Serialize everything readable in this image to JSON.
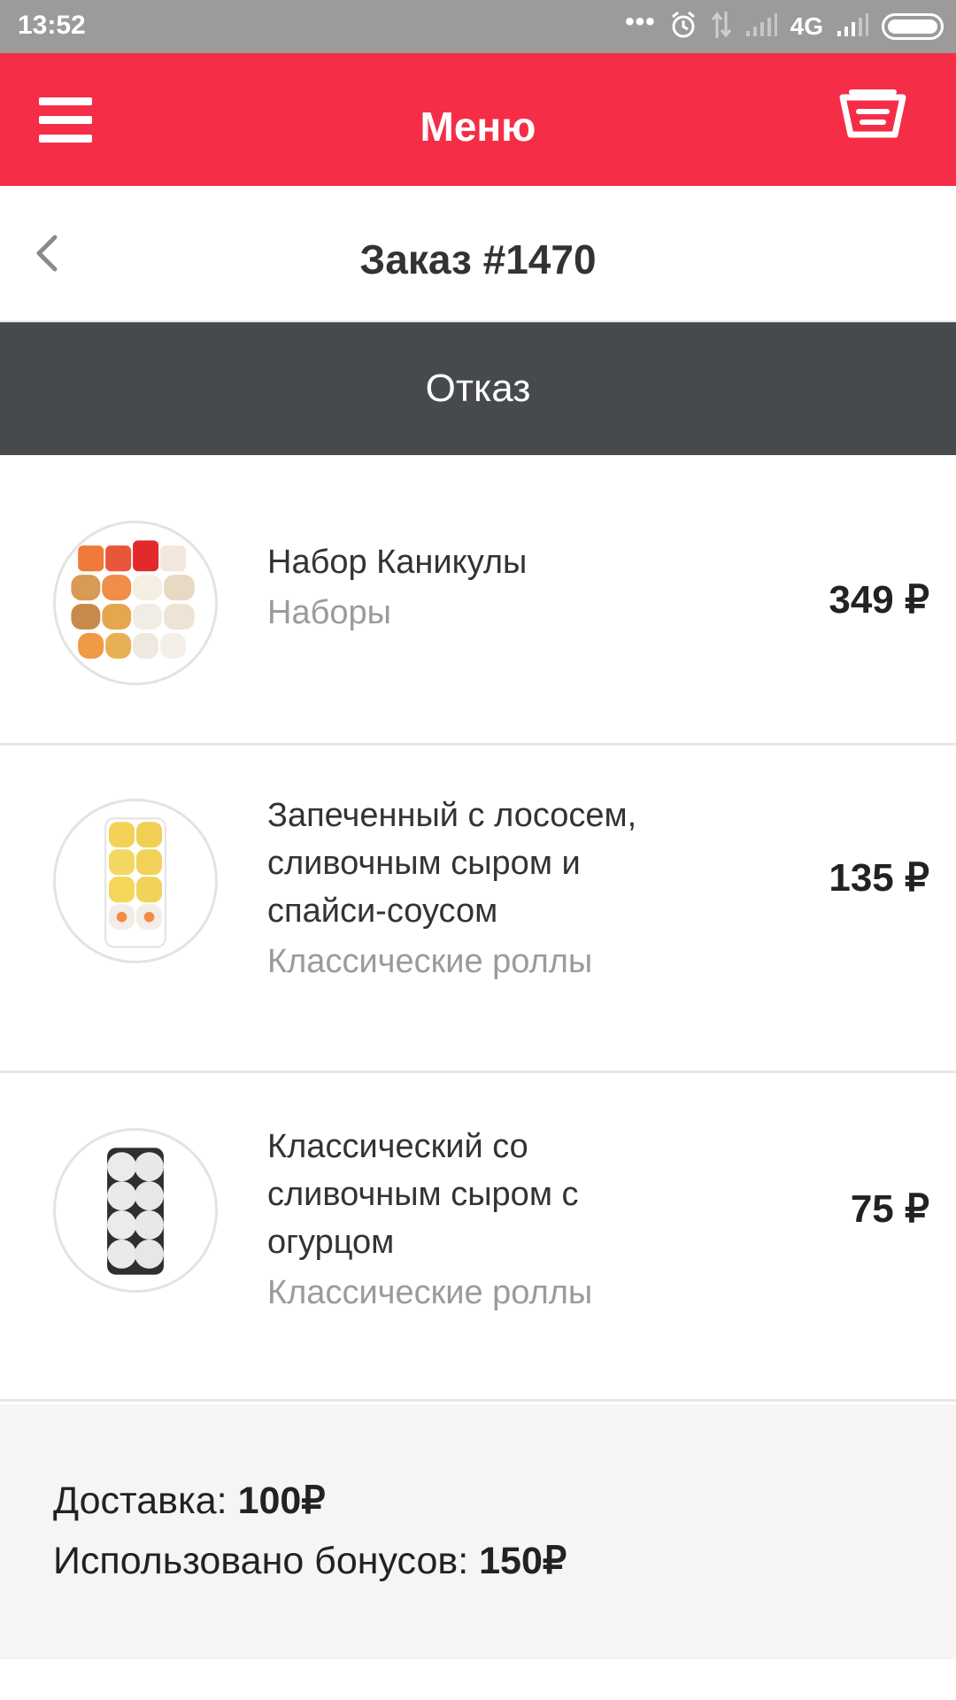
{
  "status_bar": {
    "time": "13:52",
    "network": "4G"
  },
  "app_bar": {
    "title": "Меню",
    "menu_icon": "hamburger-menu-icon",
    "cart_icon": "basket-icon"
  },
  "order": {
    "title": "Заказ #1470",
    "status": "Отказ"
  },
  "items": [
    {
      "name": "Набор Каникулы",
      "category": "Наборы",
      "price": "349 ₽"
    },
    {
      "name": "Запеченный с лососем, сливочным сыром и спайси-соусом",
      "category": "Классические роллы",
      "price": "135 ₽"
    },
    {
      "name": "Классический со сливочным сыром с огурцом",
      "category": "Классические роллы",
      "price": "75 ₽"
    }
  ],
  "summary": {
    "delivery_label": "Доставка:",
    "delivery_value": "100₽",
    "bonus_label": "Использовано бонусов:",
    "bonus_value": "150₽"
  },
  "colors": {
    "accent": "#f62d46",
    "status_banner": "#474a4d",
    "summary_bg": "#f5f5f5"
  }
}
